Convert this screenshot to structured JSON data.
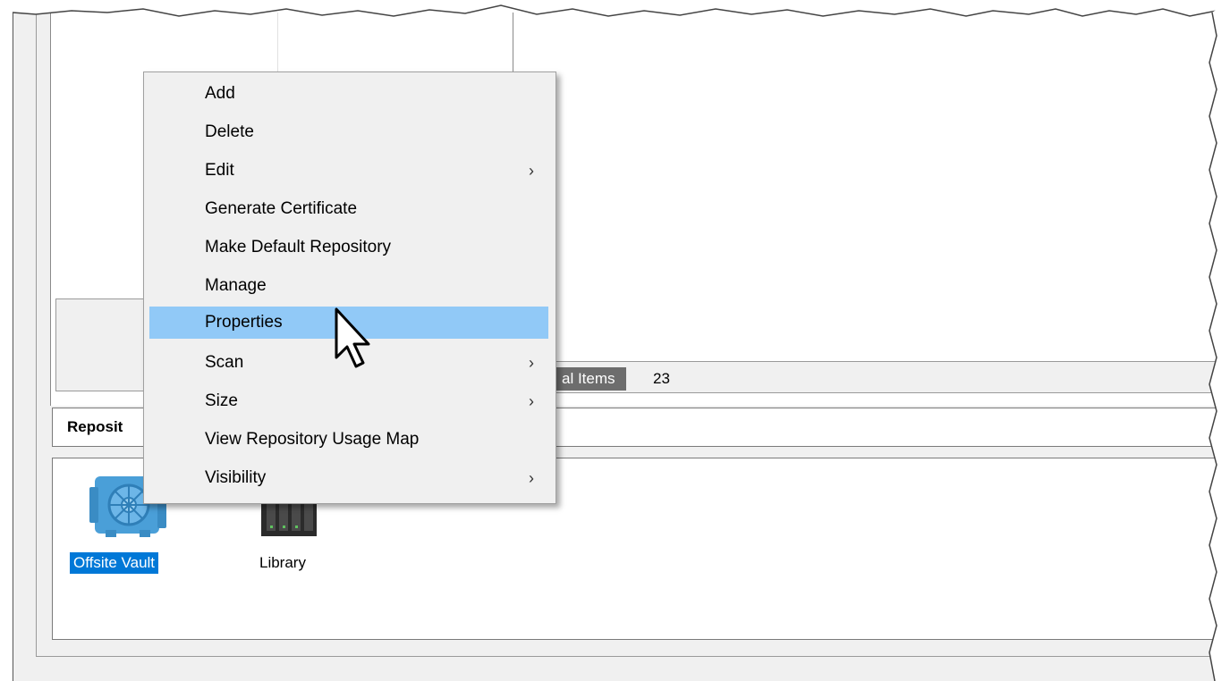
{
  "context_menu": {
    "items": [
      {
        "label": "Add",
        "submenu": false,
        "highlighted": false
      },
      {
        "label": "Delete",
        "submenu": false,
        "highlighted": false
      },
      {
        "label": "Edit",
        "submenu": true,
        "highlighted": false
      },
      {
        "label": "Generate Certificate",
        "submenu": false,
        "highlighted": false
      },
      {
        "label": "Make Default Repository",
        "submenu": false,
        "highlighted": false
      },
      {
        "label": "Manage",
        "submenu": false,
        "highlighted": false
      },
      {
        "label": "Properties",
        "submenu": false,
        "highlighted": true
      },
      {
        "label": "Scan",
        "submenu": true,
        "highlighted": false
      },
      {
        "label": "Size",
        "submenu": true,
        "highlighted": false
      },
      {
        "label": "View Repository Usage Map",
        "submenu": false,
        "highlighted": false
      },
      {
        "label": "Visibility",
        "submenu": true,
        "highlighted": false
      }
    ],
    "submenu_arrow": "›"
  },
  "status": {
    "label": "al Items",
    "value": "23"
  },
  "repositories": {
    "header": "Reposit",
    "items": [
      {
        "label": "Offsite Vault",
        "icon": "vault-icon",
        "selected": true
      },
      {
        "label": "Library",
        "icon": "library-icon",
        "selected": false
      }
    ]
  },
  "colors": {
    "menu_highlight": "#91c9f7",
    "selection": "#0078d7",
    "status_label_bg": "#6d6d6d"
  }
}
